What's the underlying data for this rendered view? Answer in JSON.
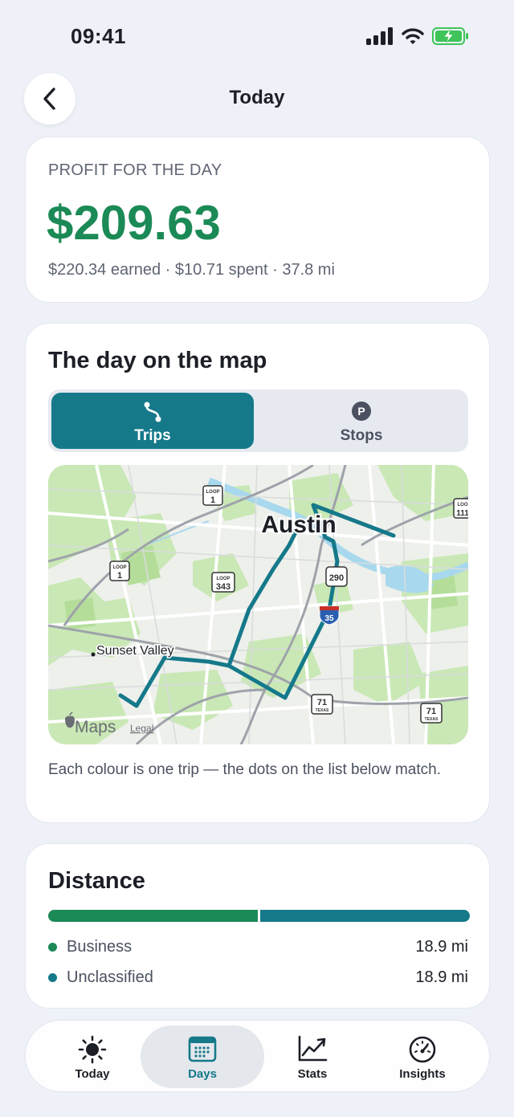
{
  "status_bar": {
    "time": "09:41"
  },
  "header": {
    "title": "Today"
  },
  "profit": {
    "label": "PROFIT FOR THE DAY",
    "value": "$209.63",
    "summary": "$220.34 earned · $10.71 spent · 37.8 mi"
  },
  "map_section": {
    "title": "The day on the map",
    "segments": [
      {
        "label": "Trips",
        "icon": "route-icon",
        "selected": true
      },
      {
        "label": "Stops",
        "icon": "parking-icon",
        "selected": false
      }
    ],
    "map": {
      "city_label": "Austin",
      "place_label": "Sunset Valley",
      "road_shields": [
        {
          "top": "LOOP",
          "number": "1"
        },
        {
          "top": "LOOP",
          "number": "1"
        },
        {
          "top": "LOOP",
          "number": "343"
        },
        {
          "top": "",
          "number": "290"
        },
        {
          "top": "",
          "number": "35"
        },
        {
          "top": "",
          "number": "71",
          "bottom": "TEXAS"
        },
        {
          "top": "",
          "number": "71",
          "bottom": "TEXAS"
        },
        {
          "top": "LOO",
          "number": "111"
        }
      ],
      "attribution": "Maps",
      "legal": "Legal"
    },
    "caption": "Each colour is one trip — the dots on the list below match.",
    "trip_color": "#15798a"
  },
  "distance": {
    "title": "Distance",
    "rows": [
      {
        "label": "Business",
        "value": "18.9 mi",
        "miles": 18.9,
        "color": "#1b8a56"
      },
      {
        "label": "Unclassified",
        "value": "18.9 mi",
        "miles": 18.9,
        "color": "#15798a"
      }
    ]
  },
  "tab_bar": {
    "tabs": [
      {
        "label": "Today",
        "icon": "sun-icon",
        "selected": false
      },
      {
        "label": "Days",
        "icon": "calendar-icon",
        "selected": true
      },
      {
        "label": "Stats",
        "icon": "chart-icon",
        "selected": false
      },
      {
        "label": "Insights",
        "icon": "gauge-icon",
        "selected": false
      }
    ]
  },
  "colors": {
    "profit_green": "#1b8a56",
    "accent_teal": "#15798a",
    "background": "#eef1f7"
  }
}
